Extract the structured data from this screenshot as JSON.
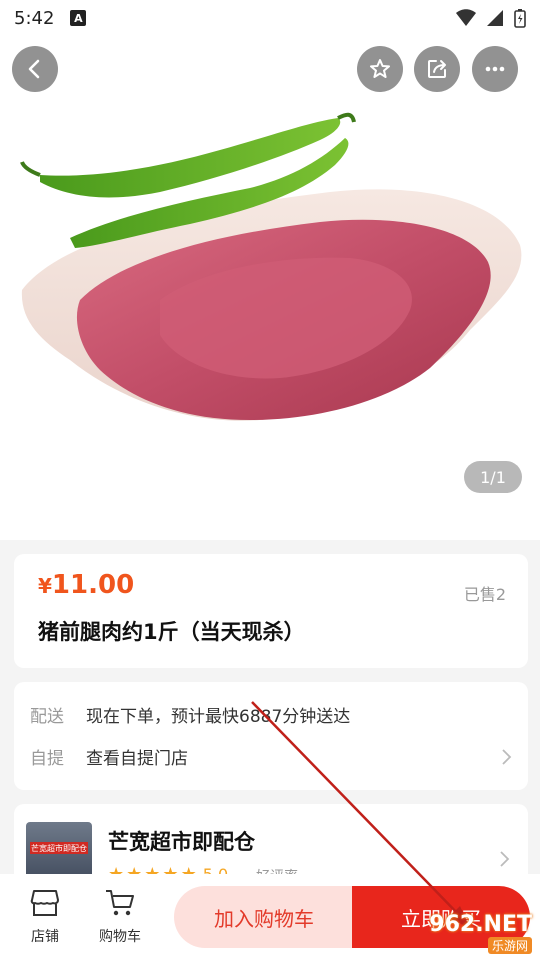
{
  "status_bar": {
    "time": "5:42",
    "a_badge": "A"
  },
  "hero": {
    "page_counter": "1/1"
  },
  "product": {
    "currency": "¥",
    "price": "11.00",
    "sold": "已售2",
    "name": "猪前腿肉约1斤（当天现杀）"
  },
  "delivery": {
    "delivery_label": "配送",
    "delivery_value": "现在下单，预计最快6887分钟送达",
    "pickup_label": "自提",
    "pickup_value": "查看自提门店"
  },
  "store": {
    "sign_text": "芒宽超市即配仓",
    "name": "芒宽超市即配仓",
    "rating": "5.0",
    "good_rate": "好评率"
  },
  "bottom_bar": {
    "shop_label": "店铺",
    "cart_label": "购物车",
    "add_to_cart": "加入购物车",
    "buy_now": "立即购买"
  },
  "watermark": {
    "top": "962.NET",
    "bottom": "乐游网"
  },
  "colors": {
    "price": "#f0551d",
    "buy": "#e8261c",
    "cart_bg": "#fde0dc",
    "star": "#f5a623"
  },
  "icons": [
    "back-icon",
    "star-icon",
    "share-icon",
    "more-icon",
    "store-icon",
    "cart-icon",
    "chevron-right-icon",
    "wifi-icon",
    "battery-icon"
  ]
}
